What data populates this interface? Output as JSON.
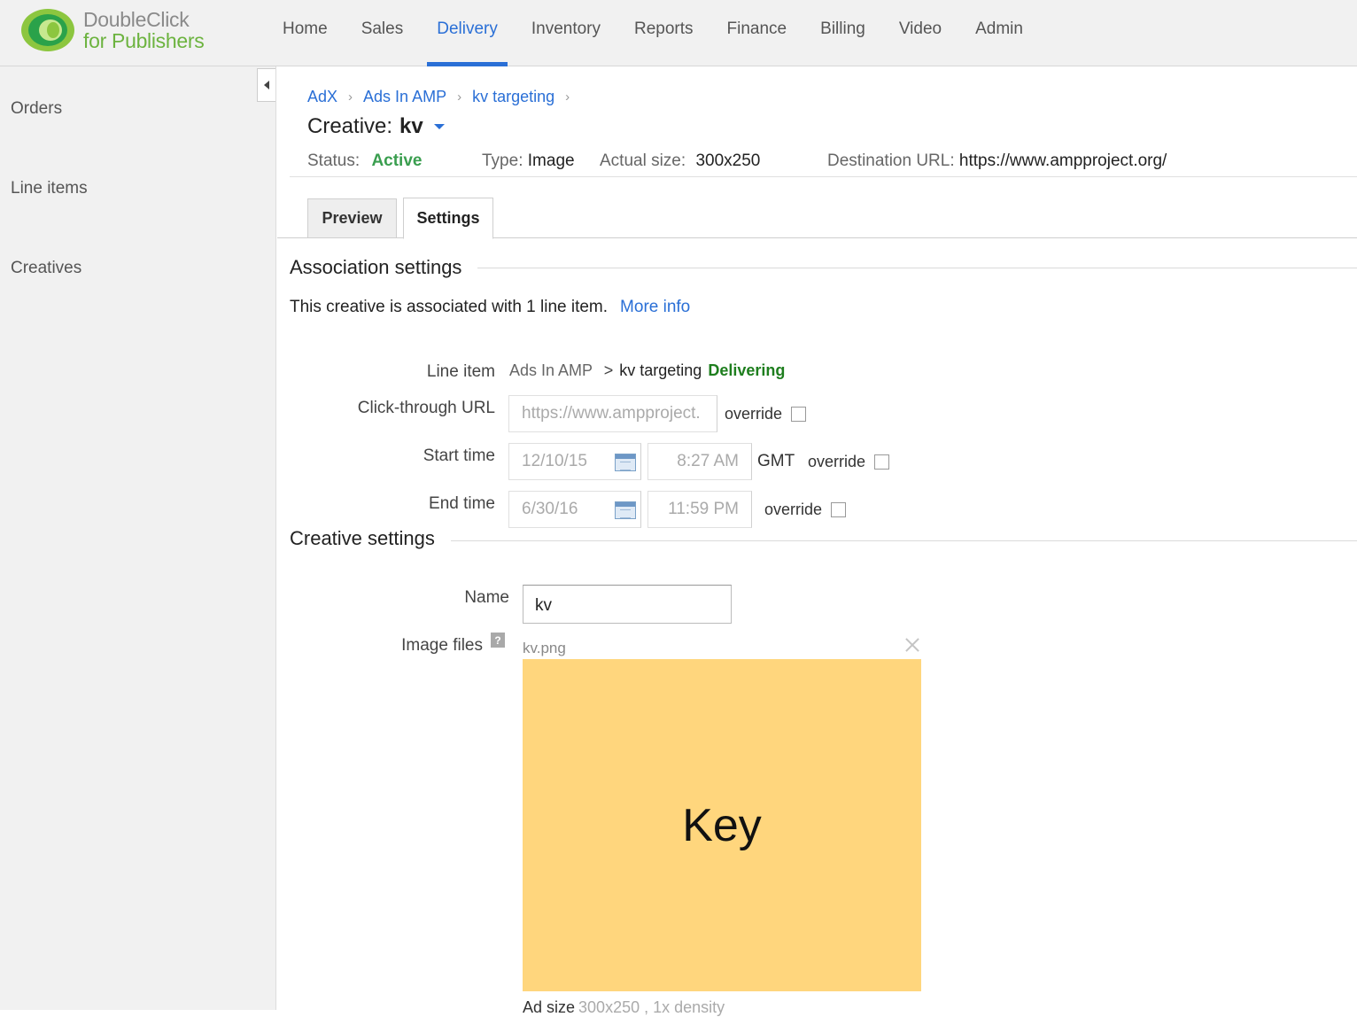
{
  "brand": {
    "line1": "DoubleClick",
    "line2": "for Publishers"
  },
  "nav": [
    {
      "label": "Home"
    },
    {
      "label": "Sales"
    },
    {
      "label": "Delivery",
      "active": true
    },
    {
      "label": "Inventory"
    },
    {
      "label": "Reports"
    },
    {
      "label": "Finance"
    },
    {
      "label": "Billing"
    },
    {
      "label": "Video"
    },
    {
      "label": "Admin"
    }
  ],
  "sidebar": {
    "items": [
      {
        "label": "Orders"
      },
      {
        "label": "Line items"
      },
      {
        "label": "Creatives"
      }
    ]
  },
  "breadcrumb": [
    "AdX",
    "Ads In AMP",
    "kv targeting"
  ],
  "breadcrumb_sep": "›",
  "creative": {
    "title_prefix": "Creative:",
    "name": "kv",
    "status_label": "Status:",
    "status": "Active",
    "type_label": "Type:",
    "type": "Image",
    "size_label": "Actual size:",
    "size": "300x250",
    "dest_label": "Destination URL:",
    "dest": "https://www.ampproject.org/"
  },
  "tabs": [
    {
      "label": "Preview"
    },
    {
      "label": "Settings",
      "active": true
    }
  ],
  "association": {
    "title": "Association settings",
    "text": "This creative is associated with 1 line item.",
    "more_info": "More info",
    "line_item_label": "Line item",
    "line_item_order": "Ads In AMP",
    "line_item_sep": ">",
    "line_item_name": "kv targeting",
    "line_item_status": "Delivering",
    "click_label": "Click-through URL",
    "click_value": "https://www.ampproject.",
    "start_label": "Start time",
    "start_date": "12/10/15",
    "start_time": "8:27 AM",
    "timezone": "GMT",
    "end_label": "End time",
    "end_date": "6/30/16",
    "end_time": "11:59 PM",
    "override_label": "override"
  },
  "creative_settings": {
    "title": "Creative settings",
    "name_label": "Name",
    "name_value": "kv",
    "image_label": "Image files",
    "help_glyph": "?",
    "file_name": "kv.png",
    "preview_text": "Key",
    "ad_size_label": "Ad size",
    "ad_size_value": "300x250 , 1x density"
  },
  "colors": {
    "accent": "#2a6fd6",
    "active_status": "#3a9e4f",
    "delivering": "#1e7e1e",
    "preview_bg": "#ffd67d"
  }
}
